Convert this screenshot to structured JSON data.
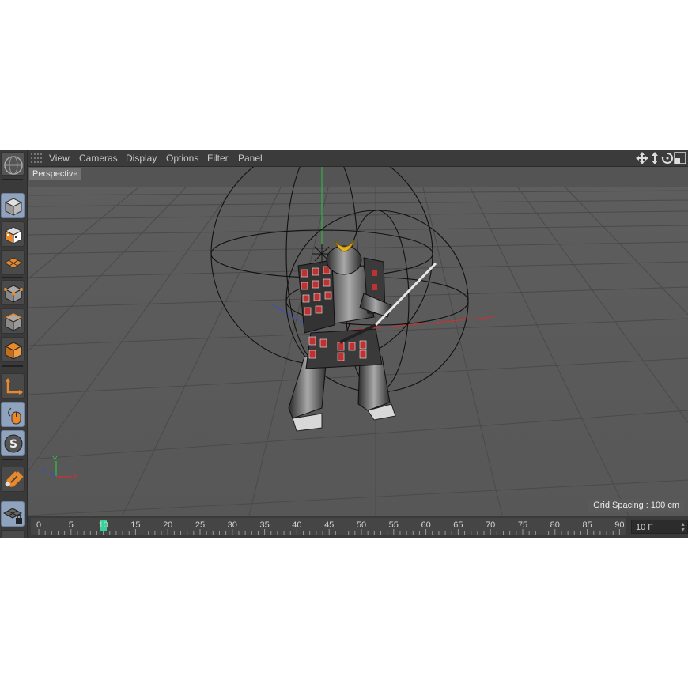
{
  "menu": {
    "items": [
      "View",
      "Cameras",
      "Display",
      "Options",
      "Filter",
      "Panel"
    ]
  },
  "viewport": {
    "view_label": "Perspective",
    "grid_spacing": "Grid Spacing : 100 cm",
    "axis_labels": {
      "x": "X",
      "y": "Y",
      "z": "Z"
    }
  },
  "toolbar": {
    "tools": [
      {
        "icon": "cube-icon",
        "active": true
      },
      {
        "icon": "checker-cube-icon",
        "active": false
      },
      {
        "icon": "texture-grid-icon",
        "active": false
      },
      {
        "icon": "points-mode-icon",
        "active": false
      },
      {
        "icon": "edges-mode-icon",
        "active": false
      },
      {
        "icon": "polygons-mode-icon",
        "active": false
      },
      {
        "icon": "axis-icon",
        "active": false
      },
      {
        "icon": "mouse-icon",
        "active": true
      },
      {
        "icon": "snap-s-icon",
        "active": true
      },
      {
        "icon": "magnet-icon",
        "active": false
      },
      {
        "icon": "locked-grid-icon",
        "active": true
      }
    ]
  },
  "timeline": {
    "ticks": [
      "0",
      "5",
      "10",
      "15",
      "20",
      "25",
      "30",
      "35",
      "40",
      "45",
      "50",
      "55",
      "60",
      "65",
      "70",
      "75",
      "80",
      "85",
      "90"
    ],
    "current_frame": 10,
    "frame_field": "10 F"
  },
  "colors": {
    "axis_x": "#d03030",
    "axis_y": "#30c040",
    "axis_z": "#3050d0",
    "playhead": "#35d29a",
    "toolbar_active": "#8fa3bf"
  }
}
